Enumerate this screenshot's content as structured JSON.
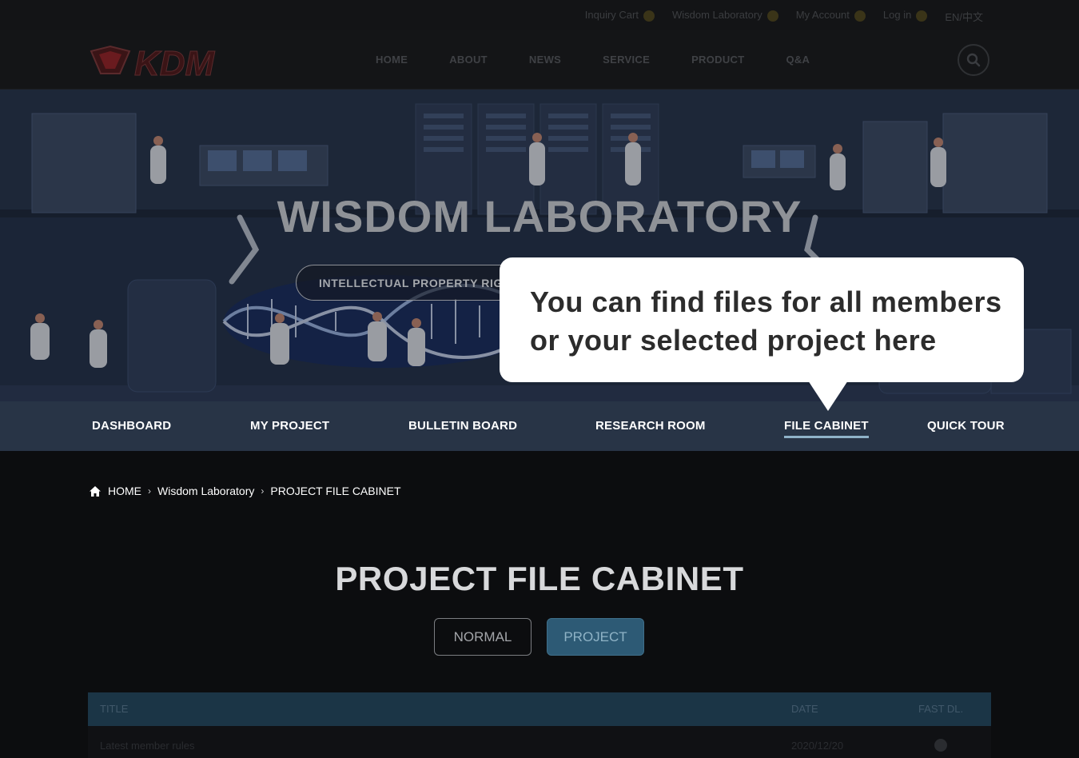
{
  "topbar": {
    "links": [
      "Inquiry Cart",
      "Wisdom Laboratory",
      "My Account",
      "Log in",
      "EN/中文"
    ]
  },
  "header": {
    "brand": "KDM",
    "nav": [
      "HOME",
      "ABOUT",
      "NEWS",
      "SERVICE",
      "PRODUCT",
      "Q&A"
    ]
  },
  "hero": {
    "title": "WISDOM LABORATORY",
    "pill_text": "INTELLECTUAL PROPERTY RIG"
  },
  "tooltip": {
    "text": "You can find files for all members or your selected project here"
  },
  "lab_nav": {
    "items": [
      {
        "label": "DASHBOARD"
      },
      {
        "label": "MY PROJECT"
      },
      {
        "label": "BULLETIN BOARD"
      },
      {
        "label": "RESEARCH ROOM"
      },
      {
        "label": "FILE CABINET",
        "active": true
      },
      {
        "label": "QUICK TOUR"
      }
    ]
  },
  "breadcrumb": [
    "HOME",
    "Wisdom Laboratory",
    "PROJECT FILE CABINET"
  ],
  "section": {
    "title": "PROJECT FILE CABINET",
    "tabs": [
      {
        "label": "NORMAL",
        "selected": false
      },
      {
        "label": "PROJECT",
        "selected": true
      }
    ]
  },
  "table": {
    "headers": {
      "title": "TITLE",
      "date": "DATE",
      "fast_dl": "FAST DL."
    },
    "rows": [
      {
        "title": "Latest member rules",
        "date": "2020/12/20"
      }
    ]
  },
  "colors": {
    "accent": "#2d5a75",
    "lab_nav_bg": "#283446",
    "active_underline": "#8fb2c8"
  }
}
